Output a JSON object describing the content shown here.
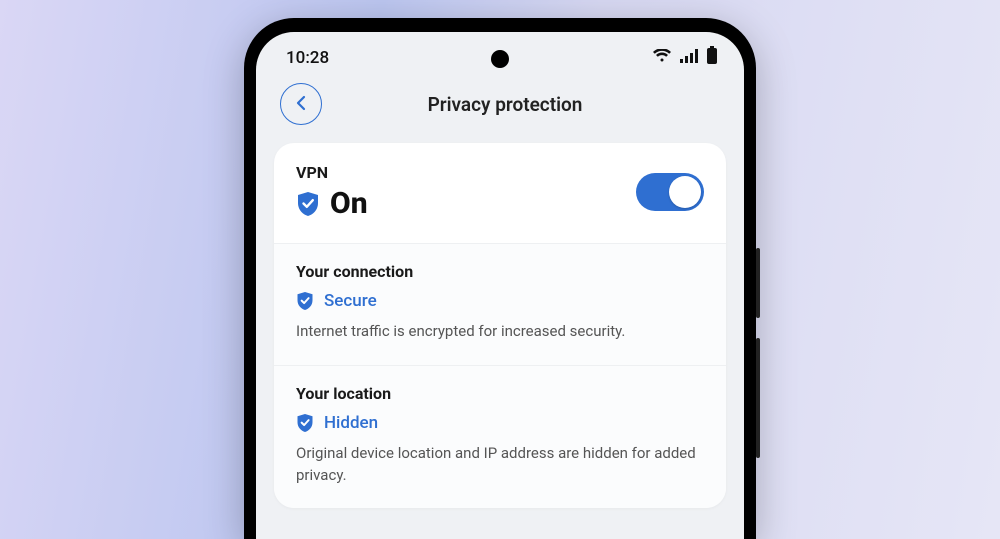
{
  "status": {
    "time": "10:28"
  },
  "header": {
    "title": "Privacy protection"
  },
  "vpn": {
    "label": "VPN",
    "state": "On",
    "enabled": true
  },
  "connection": {
    "title": "Your connection",
    "status": "Secure",
    "desc": "Internet traffic is encrypted for increased security."
  },
  "location": {
    "title": "Your location",
    "status": "Hidden",
    "desc": "Original device location and IP address are hidden for added privacy."
  },
  "colors": {
    "accent": "#2f6fd1"
  }
}
